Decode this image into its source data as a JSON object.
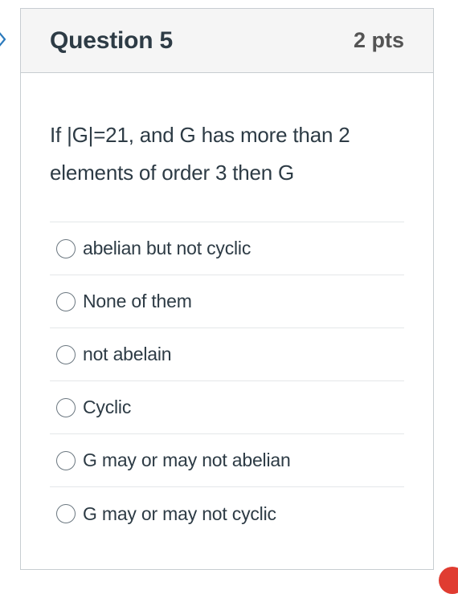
{
  "question": {
    "title": "Question 5",
    "points": "2 pts",
    "text_line1": "If |G|=21, and G has more than 2",
    "text_line2": "elements of order 3 then G"
  },
  "answers": [
    {
      "label": "abelian but not cyclic",
      "selected": false
    },
    {
      "label": "None of them",
      "selected": false
    },
    {
      "label": "not abelain",
      "selected": false
    },
    {
      "label": "Cyclic",
      "selected": false
    },
    {
      "label": "G may or may not abelian",
      "selected": false
    },
    {
      "label": "G may or may not cyclic",
      "selected": false
    }
  ],
  "icons": {
    "nav_prev": "chevron-right-icon"
  },
  "colors": {
    "text": "#2d3b45",
    "header_bg": "#f5f5f5",
    "border": "#c7cdd1",
    "chevron": "#2b7abc",
    "corner_accent": "#e03c31"
  }
}
